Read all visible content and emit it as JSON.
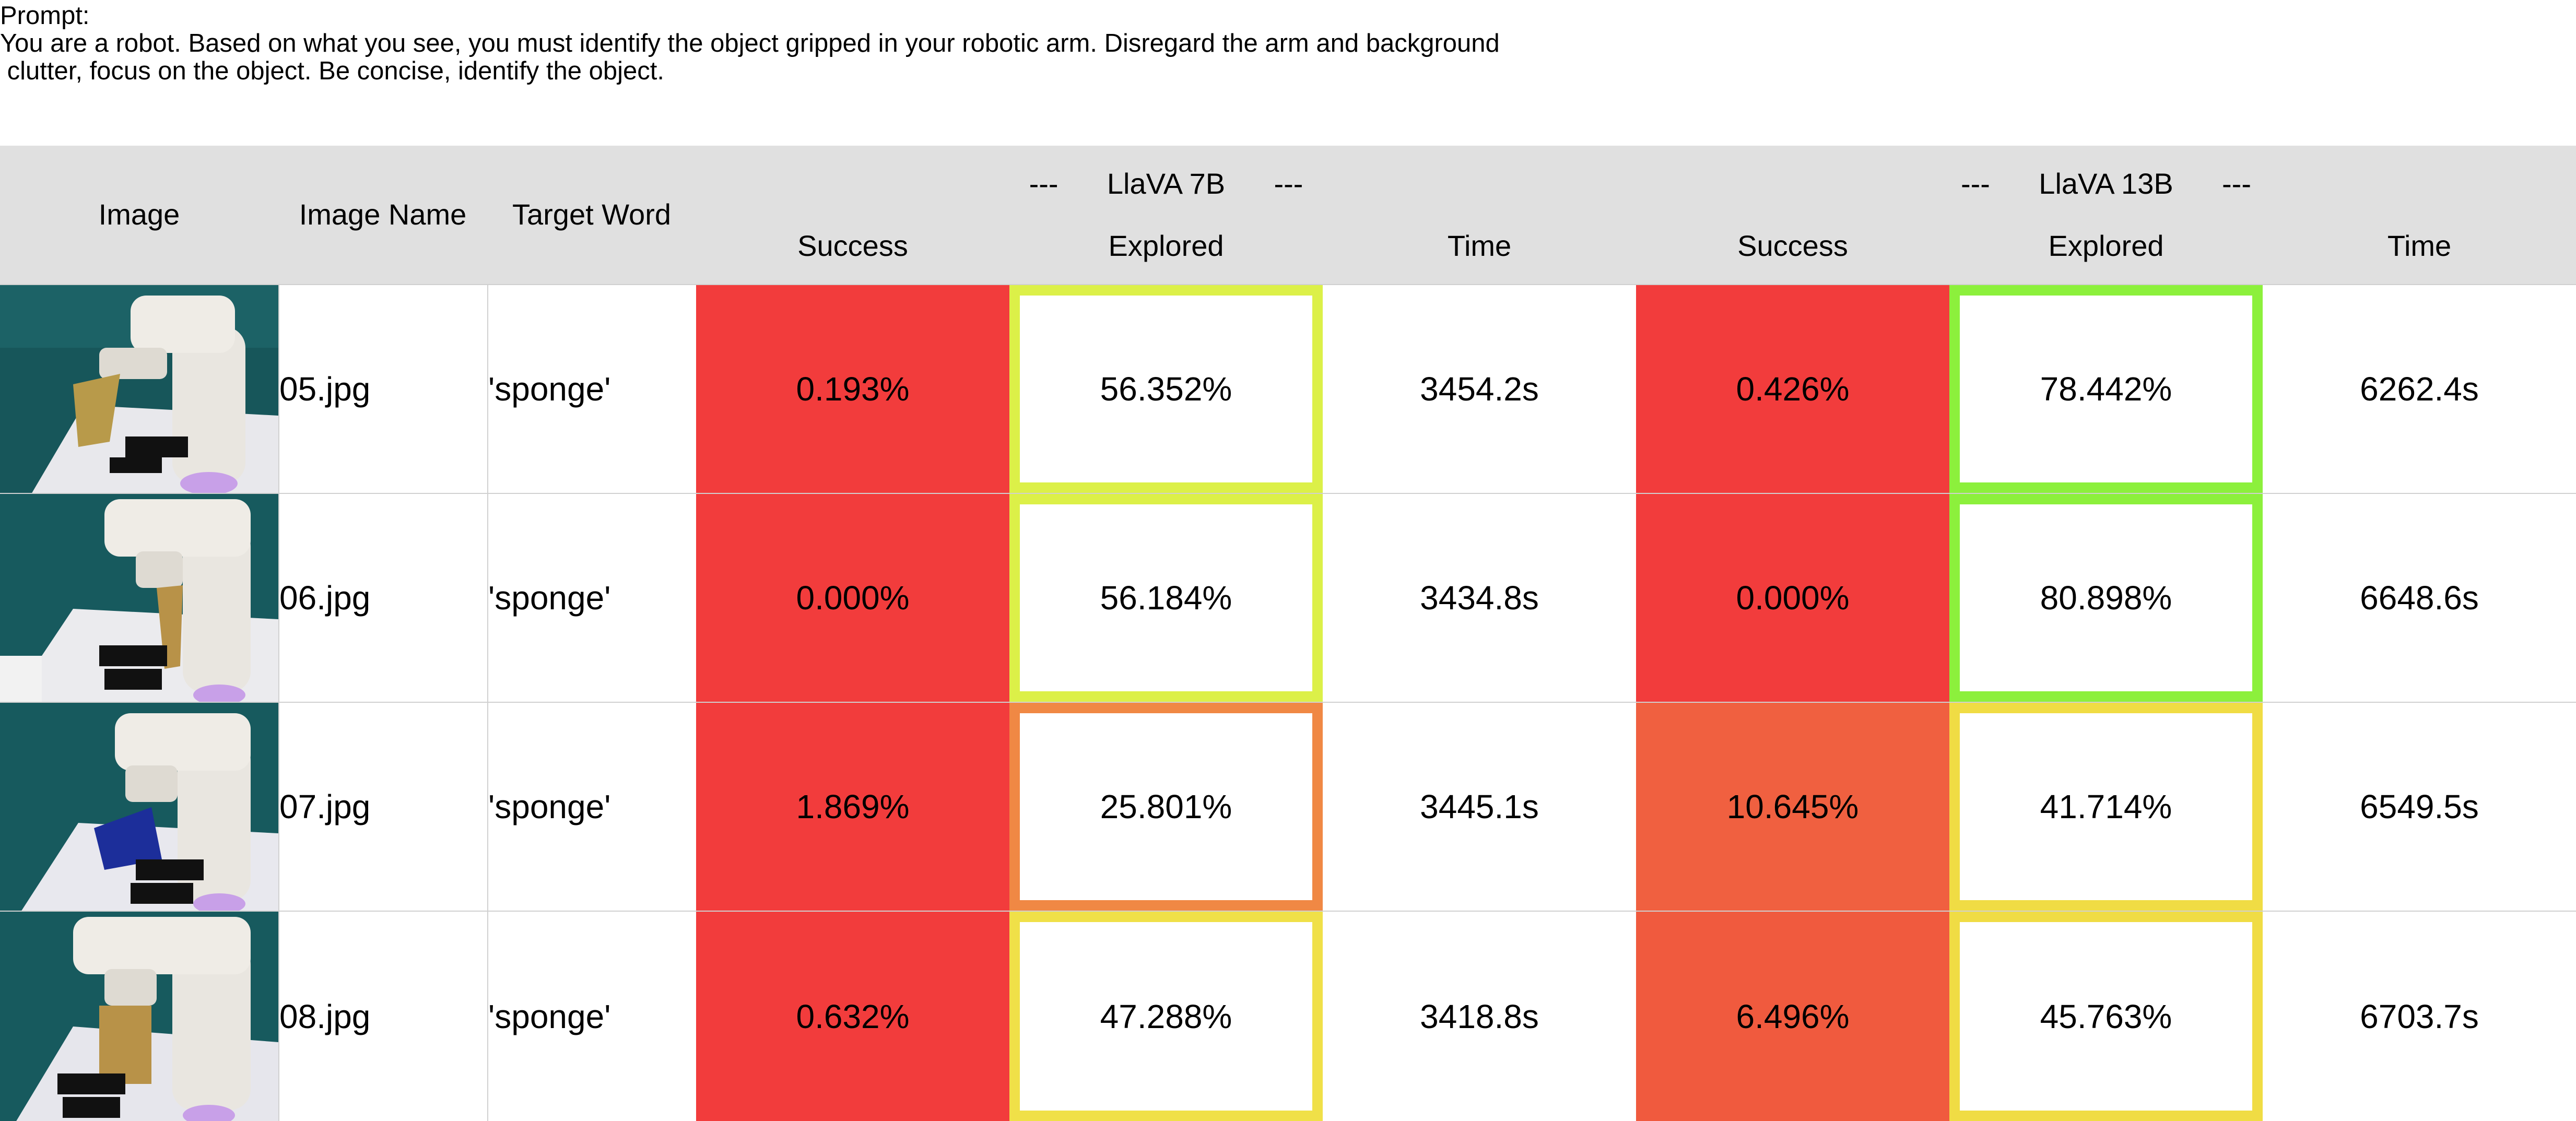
{
  "prompt": {
    "line1": "Prompt:",
    "line2": "You are a robot. Based on what you see, you must identify the object gripped in your robotic arm. Disregard the arm and background",
    "line3": " clutter, focus on the object. Be concise, identify the object."
  },
  "header": {
    "image": "Image",
    "image_name": "Image Name",
    "target_word": "Target Word",
    "group_7b": "---      LlaVA 7B      ---",
    "group_13b": "---      LlaVA 13B      ---",
    "success": "Success",
    "explored": "Explored",
    "time": "Time"
  },
  "colors": {
    "header_bg": "#e0e0e0",
    "red": "#f23c3c",
    "orange_red": "#f06040",
    "orange": "#f08844",
    "yellow_green": "#dcf048",
    "green": "#8cf03c",
    "yellow": "#f0e048",
    "yellow2": "#f0dc44"
  },
  "rows": [
    {
      "image_icon": "robot-arm-gripping-sponge-photo",
      "image_name": "05.jpg",
      "target_word": "'sponge'",
      "llava7b": {
        "success": "0.193%",
        "explored": "56.352%",
        "time": "3454.2s"
      },
      "llava13b": {
        "success": "0.426%",
        "explored": "78.442%",
        "time": "6262.4s"
      }
    },
    {
      "image_icon": "robot-arm-gripping-sponge-photo",
      "image_name": "06.jpg",
      "target_word": "'sponge'",
      "llava7b": {
        "success": "0.000%",
        "explored": "56.184%",
        "time": "3434.8s"
      },
      "llava13b": {
        "success": "0.000%",
        "explored": "80.898%",
        "time": "6648.6s"
      }
    },
    {
      "image_icon": "robot-arm-gripping-sponge-photo",
      "image_name": "07.jpg",
      "target_word": "'sponge'",
      "llava7b": {
        "success": "1.869%",
        "explored": "25.801%",
        "time": "3445.1s"
      },
      "llava13b": {
        "success": "10.645%",
        "explored": "41.714%",
        "time": "6549.5s"
      }
    },
    {
      "image_icon": "robot-arm-gripping-sponge-photo",
      "image_name": "08.jpg",
      "target_word": "'sponge'",
      "llava7b": {
        "success": "0.632%",
        "explored": "47.288%",
        "time": "3418.8s"
      },
      "llava13b": {
        "success": "6.496%",
        "explored": "45.763%",
        "time": "6703.7s"
      }
    }
  ]
}
